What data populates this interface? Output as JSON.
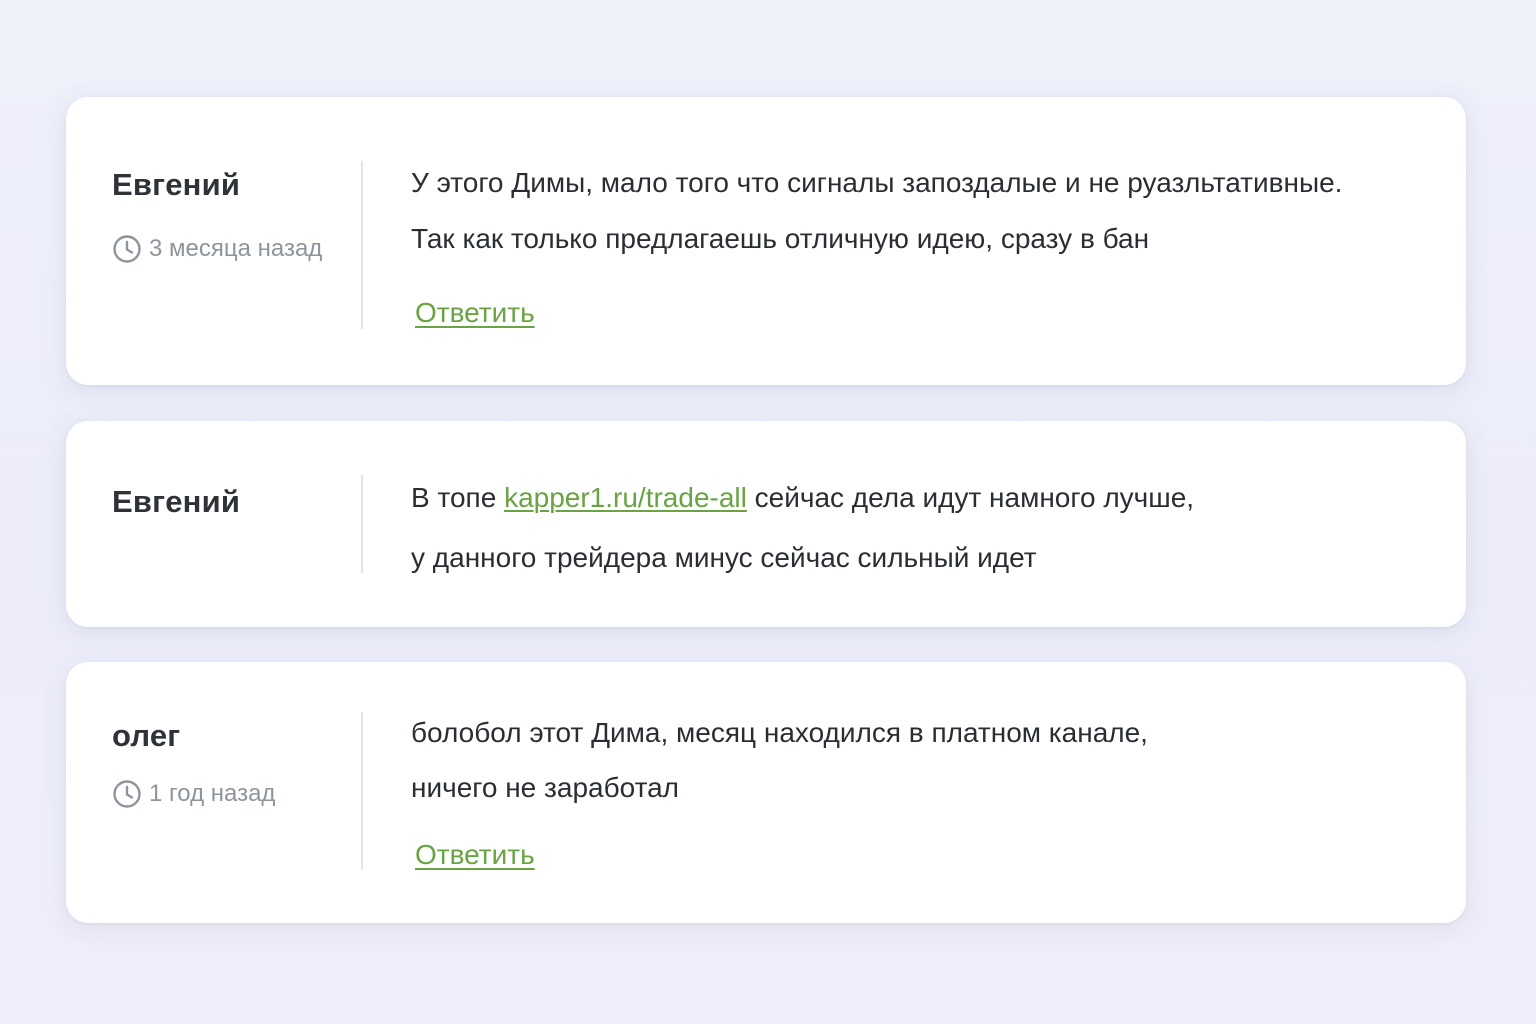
{
  "colors": {
    "accent_link": "#6aa343",
    "text_primary": "#2a2e33",
    "text_muted": "#8e949c",
    "card_background": "#ffffff",
    "page_background": "#eef0fa"
  },
  "comments": [
    {
      "author": "Евгений",
      "time": "3 месяца назад",
      "time_icon": "clock-icon",
      "lines": [
        "У этого Димы, мало того что сигналы запоздалые и не руазльтативные.",
        "Так как только предлагаешь отличную идею, сразу в бан"
      ],
      "reply_label": "Ответить"
    },
    {
      "author": "Евгений",
      "line1_prefix": "В топе ",
      "line1_link": "kapper1.ru/trade-all",
      "line1_suffix": " сейчас дела идут намного лучше,",
      "line2": "у данного трейдера минус сейчас сильный идет"
    },
    {
      "author": "олег",
      "time": "1 год назад",
      "time_icon": "clock-icon",
      "lines": [
        "болобол этот Дима, месяц находился в платном канале,",
        "ничего не заработал"
      ],
      "reply_label": "Ответить"
    }
  ]
}
